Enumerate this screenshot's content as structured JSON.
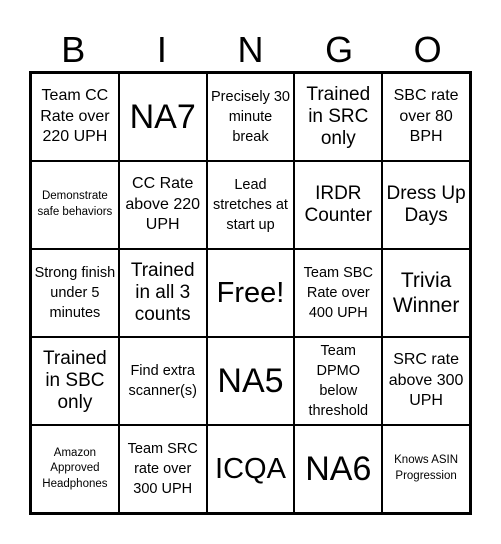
{
  "header": [
    "B",
    "I",
    "N",
    "G",
    "O"
  ],
  "cells": [
    "Team CC Rate over 220 UPH",
    "NA7",
    "Precisely 30 minute break",
    "Trained in SRC only",
    "SBC rate over 80 BPH",
    "Demonstrate safe behaviors",
    "CC Rate above 220 UPH",
    "Lead stretches at start up",
    "IRDR Counter",
    "Dress Up Days",
    "Strong finish under 5 minutes",
    "Trained in all 3 counts",
    "Free!",
    "Team SBC Rate over 400 UPH",
    "Trivia Winner",
    "Trained in SBC only",
    "Find extra scanner(s)",
    "NA5",
    "Team DPMO below threshold",
    "SRC rate above 300 UPH",
    "Amazon Approved Headphones",
    "Team SRC rate over 300 UPH",
    "ICQA",
    "NA6",
    "Knows ASIN Progression"
  ]
}
